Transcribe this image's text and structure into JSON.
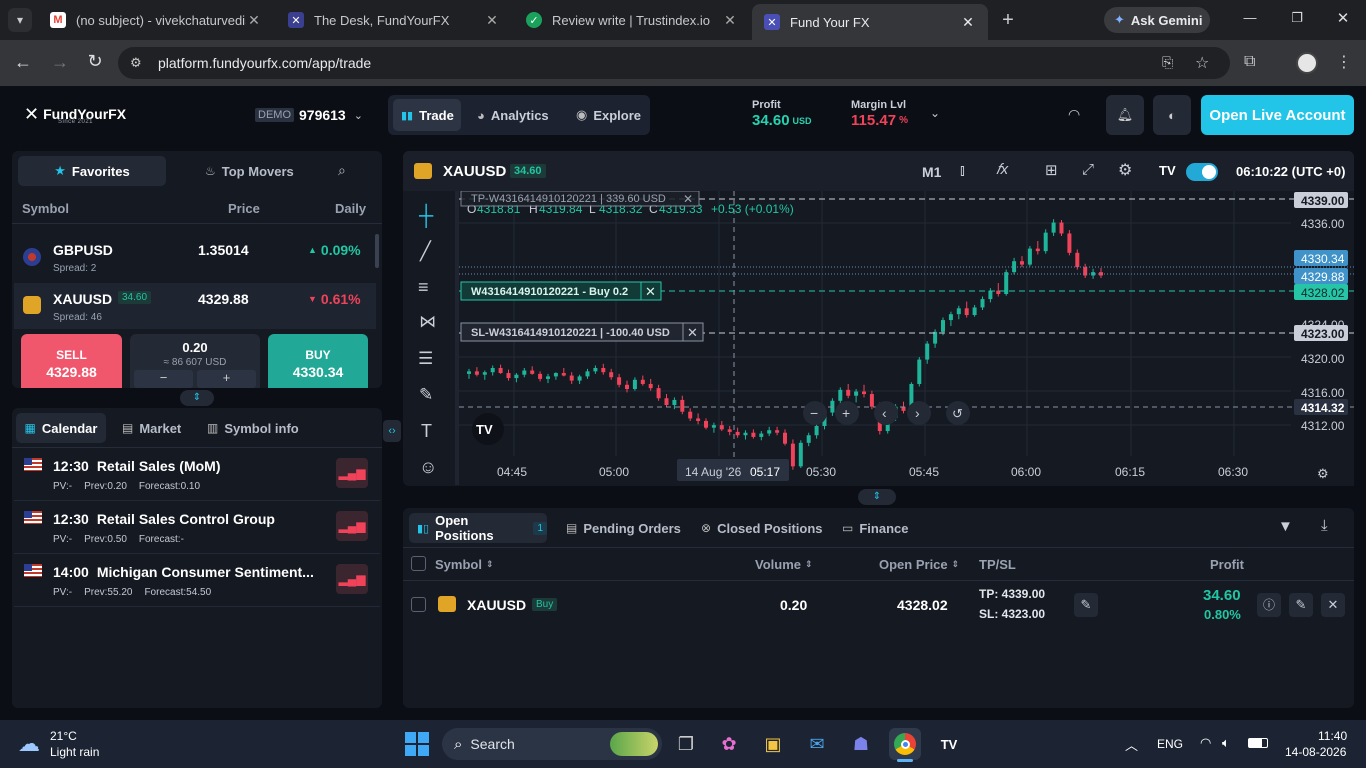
{
  "browser": {
    "tabs": [
      {
        "title": "(no subject) - vivekchaturvedi5"
      },
      {
        "title": "The Desk, FundYourFX"
      },
      {
        "title": "Review write | Trustindex.io"
      },
      {
        "title": "Fund Your FX"
      }
    ],
    "gemini_label": "Ask Gemini",
    "url": "platform.fundyourfx.com/app/trade"
  },
  "header": {
    "logo_text": "FundYourFX",
    "logo_sub": "Since 2021",
    "account_type": "DEMO",
    "account_number": "979613",
    "nav": [
      "Trade",
      "Analytics",
      "Explore"
    ],
    "profit_label": "Profit",
    "profit_value": "34.60",
    "profit_currency": "USD",
    "margin_label": "Margin Lvl",
    "margin_value": "115.47",
    "margin_unit": "%",
    "open_live_label": "Open Live Account"
  },
  "watchlist": {
    "tabs": [
      "Favorites",
      "Top Movers"
    ],
    "columns": [
      "Symbol",
      "Price",
      "Daily"
    ],
    "rows": [
      {
        "symbol": "GBPUSD",
        "spread": "Spread: 2",
        "price": "1.35014",
        "change": "0.09%",
        "badge": ""
      },
      {
        "symbol": "XAUUSD",
        "spread": "Spread: 46",
        "price": "4329.88",
        "change": "0.61%",
        "badge": "34.60"
      }
    ],
    "sell_label": "SELL",
    "sell_price": "4329.88",
    "buy_label": "BUY",
    "buy_price": "4330.34",
    "volume": "0.20",
    "volume_usd": "≈ 86 607 USD"
  },
  "info_tabs": [
    "Calendar",
    "Market",
    "Symbol info"
  ],
  "calendar": [
    {
      "time": "12:30",
      "title": "Retail Sales (MoM)",
      "pv": "PV:-",
      "prev": "Prev:0.20",
      "forecast": "Forecast:0.10"
    },
    {
      "time": "12:30",
      "title": "Retail Sales Control Group",
      "pv": "PV:-",
      "prev": "Prev:0.50",
      "forecast": "Forecast:-"
    },
    {
      "time": "14:00",
      "title": "Michigan Consumer Sentiment...",
      "pv": "PV:-",
      "prev": "Prev:55.20",
      "forecast": "Forecast:54.50"
    }
  ],
  "chart": {
    "symbol": "XAUUSD",
    "badge": "34.60",
    "timeframe": "M1",
    "clock": "06:10:22 (UTC +0)",
    "ohlc": {
      "o": "4318.81",
      "h": "4319.84",
      "l": "4318.32",
      "c": "4319.33",
      "chg": "+0.53 (+0.01%)"
    },
    "tp_line_label": "TP-W4316414910120221 | 339.60 USD",
    "position_label": "W4316414910120221 - Buy 0.2",
    "sl_line_label": "SL-W4316414910120221 | -100.40 USD",
    "crosshair_date": "14 Aug '26",
    "crosshair_time": "05:17",
    "price_ticks": [
      "4336.00",
      "4320.00",
      "4316.00",
      "4312.00"
    ],
    "price_labels": {
      "tp": "4339.00",
      "ask": "4330.34",
      "bid": "4329.88",
      "entry": "4328.02",
      "sl": "4323.00",
      "cursor": "4314.32",
      "hidden": "4324.00"
    },
    "time_ticks": [
      "04:45",
      "05:00",
      "05:30",
      "05:45",
      "06:00",
      "06:15",
      "06:30"
    ]
  },
  "chart_data": {
    "type": "candlestick",
    "ylim": [
      4310,
      4341
    ],
    "candles": [
      [
        4318.2,
        4318.8,
        4317.6,
        4318.5
      ],
      [
        4318.5,
        4319.0,
        4317.9,
        4318.1
      ],
      [
        4318.1,
        4318.6,
        4317.5,
        4318.4
      ],
      [
        4318.4,
        4319.2,
        4318.0,
        4318.9
      ],
      [
        4318.9,
        4319.3,
        4318.2,
        4318.3
      ],
      [
        4318.3,
        4318.7,
        4317.4,
        4317.7
      ],
      [
        4317.7,
        4318.3,
        4317.2,
        4318.1
      ],
      [
        4318.1,
        4318.9,
        4317.8,
        4318.6
      ],
      [
        4318.6,
        4319.1,
        4318.1,
        4318.2
      ],
      [
        4318.2,
        4318.5,
        4317.3,
        4317.6
      ],
      [
        4317.6,
        4318.2,
        4317.1,
        4317.9
      ],
      [
        4317.9,
        4318.4,
        4317.5,
        4318.3
      ],
      [
        4318.3,
        4318.9,
        4317.9,
        4318.0
      ],
      [
        4318.0,
        4318.4,
        4317.0,
        4317.4
      ],
      [
        4317.4,
        4318.1,
        4317.0,
        4317.9
      ],
      [
        4317.9,
        4318.8,
        4317.6,
        4318.5
      ],
      [
        4318.5,
        4319.2,
        4318.2,
        4318.9
      ],
      [
        4318.9,
        4319.4,
        4318.1,
        4318.4
      ],
      [
        4318.4,
        4318.8,
        4317.5,
        4317.8
      ],
      [
        4317.8,
        4318.2,
        4316.6,
        4316.9
      ],
      [
        4316.9,
        4317.4,
        4316.0,
        4316.4
      ],
      [
        4316.4,
        4317.8,
        4316.2,
        4317.5
      ],
      [
        4317.5,
        4318.0,
        4316.8,
        4317.0
      ],
      [
        4317.0,
        4317.6,
        4316.2,
        4316.5
      ],
      [
        4316.5,
        4316.9,
        4315.0,
        4315.3
      ],
      [
        4315.3,
        4315.8,
        4314.2,
        4314.5
      ],
      [
        4314.5,
        4315.4,
        4314.0,
        4315.1
      ],
      [
        4315.1,
        4315.6,
        4313.4,
        4313.7
      ],
      [
        4313.7,
        4314.1,
        4312.6,
        4312.9
      ],
      [
        4312.9,
        4313.5,
        4312.2,
        4312.6
      ],
      [
        4312.6,
        4312.9,
        4311.6,
        4311.8
      ],
      [
        4311.8,
        4312.4,
        4311.2,
        4312.1
      ],
      [
        4312.1,
        4312.6,
        4311.4,
        4311.6
      ],
      [
        4311.6,
        4312.0,
        4310.9,
        4311.3
      ],
      [
        4311.3,
        4311.8,
        4310.6,
        4310.9
      ],
      [
        4310.9,
        4311.5,
        4310.4,
        4311.2
      ],
      [
        4311.2,
        4311.6,
        4310.5,
        4310.7
      ],
      [
        4310.7,
        4311.4,
        4310.3,
        4311.1
      ],
      [
        4311.1,
        4311.9,
        4310.8,
        4311.5
      ],
      [
        4311.5,
        4311.9,
        4310.9,
        4311.2
      ],
      [
        4311.2,
        4311.6,
        4309.7,
        4309.9
      ],
      [
        4309.9,
        4310.4,
        4306.8,
        4307.2
      ],
      [
        4307.2,
        4310.3,
        4307.0,
        4310.0
      ],
      [
        4310.0,
        4311.2,
        4309.6,
        4310.9
      ],
      [
        4310.9,
        4312.3,
        4310.5,
        4312.0
      ],
      [
        4312.0,
        4313.9,
        4311.6,
        4313.6
      ],
      [
        4313.6,
        4315.3,
        4313.2,
        4315.0
      ],
      [
        4315.0,
        4316.6,
        4314.5,
        4316.3
      ],
      [
        4316.3,
        4317.0,
        4315.3,
        4315.6
      ],
      [
        4315.6,
        4316.4,
        4314.8,
        4316.1
      ],
      [
        4316.1,
        4316.9,
        4315.4,
        4315.8
      ],
      [
        4315.8,
        4316.2,
        4314.0,
        4314.3
      ],
      [
        4314.3,
        4314.8,
        4311.0,
        4311.4
      ],
      [
        4311.4,
        4313.3,
        4311.1,
        4313.0
      ],
      [
        4313.0,
        4314.6,
        4312.6,
        4314.3
      ],
      [
        4314.3,
        4314.9,
        4313.5,
        4313.8
      ],
      [
        4313.8,
        4317.2,
        4313.5,
        4317.0
      ],
      [
        4317.0,
        4320.2,
        4316.7,
        4319.9
      ],
      [
        4319.9,
        4322.1,
        4319.4,
        4321.8
      ],
      [
        4321.8,
        4323.5,
        4321.3,
        4323.2
      ],
      [
        4323.2,
        4324.9,
        4322.8,
        4324.6
      ],
      [
        4324.6,
        4325.6,
        4323.9,
        4325.3
      ],
      [
        4325.3,
        4326.3,
        4324.7,
        4326.0
      ],
      [
        4326.0,
        4326.8,
        4324.9,
        4325.2
      ],
      [
        4325.2,
        4326.4,
        4325.0,
        4326.1
      ],
      [
        4326.1,
        4327.4,
        4325.8,
        4327.1
      ],
      [
        4327.1,
        4328.4,
        4326.7,
        4328.1
      ],
      [
        4328.1,
        4329.0,
        4327.4,
        4327.7
      ],
      [
        4327.7,
        4330.6,
        4327.5,
        4330.3
      ],
      [
        4330.3,
        4332.0,
        4330.0,
        4331.6
      ],
      [
        4331.6,
        4332.2,
        4330.9,
        4331.2
      ],
      [
        4331.2,
        4333.4,
        4331.0,
        4333.1
      ],
      [
        4333.1,
        4334.0,
        4332.4,
        4332.8
      ],
      [
        4332.8,
        4335.4,
        4332.5,
        4335.0
      ],
      [
        4335.0,
        4336.6,
        4334.6,
        4336.2
      ],
      [
        4336.2,
        4336.5,
        4334.6,
        4334.9
      ],
      [
        4334.9,
        4335.3,
        4332.3,
        4332.6
      ],
      [
        4332.6,
        4333.0,
        4330.6,
        4330.9
      ],
      [
        4330.9,
        4331.3,
        4329.6,
        4329.9
      ],
      [
        4329.9,
        4330.7,
        4329.5,
        4330.3
      ],
      [
        4330.3,
        4330.8,
        4329.6,
        4329.9
      ]
    ]
  },
  "positions": {
    "tabs": [
      "Open Positions",
      "Pending Orders",
      "Closed Positions",
      "Finance"
    ],
    "open_count": "1",
    "columns": [
      "Symbol",
      "Volume",
      "Open Price",
      "TP/SL",
      "Profit"
    ],
    "rows": [
      {
        "symbol": "XAUUSD",
        "side": "Buy",
        "volume": "0.20",
        "open_price": "4328.02",
        "tp": "TP: 4339.00",
        "sl": "SL: 4323.00",
        "profit": "34.60",
        "profit_pct": "0.80%"
      }
    ]
  },
  "taskbar": {
    "weather_temp": "21°C",
    "weather_text": "Light rain",
    "search_label": "Search",
    "lang": "ENG",
    "time": "11:40",
    "date": "14-08-2026"
  },
  "colors": {
    "accent": "#22c4e8",
    "buy": "#21a896",
    "sell": "#f0566c",
    "up": "#1fb59a",
    "down": "#f0435a"
  }
}
